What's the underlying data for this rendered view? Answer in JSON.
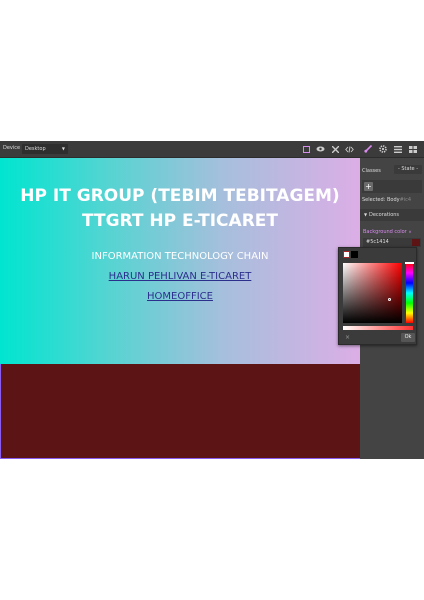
{
  "toolbar": {
    "device_label": "Device",
    "device_value": "Desktop",
    "icons": [
      "square-outline-icon",
      "eye-icon",
      "fullscreen-icon",
      "code-icon",
      "paintbrush-icon",
      "gear-icon",
      "menu-icon",
      "blocks-icon"
    ],
    "active_icon_color": "#d98cf0"
  },
  "canvas": {
    "title_line1": "HP IT GROUP (TEBIM TEBITAGEM)",
    "title_line2": "TTGRT HP E-TICARET",
    "subtitle": "INFORMATION TECHNOLOGY CHAIN",
    "link1": "HARUN PEHLIVAN E-TICARET",
    "link2": "HOMEOFFICE",
    "band_color": "#5c1414"
  },
  "panel": {
    "classes_label": "Classes",
    "state_label": "- State -",
    "add_label": "+",
    "selected_label": "Selected:",
    "selected_value": "Body",
    "selected_extra": "#ic4",
    "decorations_label": "Decorations",
    "bgcolor_label": "Background color",
    "bgcolor_value": "#5c1414"
  },
  "picker": {
    "cancel_label": "×",
    "ok_label": "Ok"
  }
}
